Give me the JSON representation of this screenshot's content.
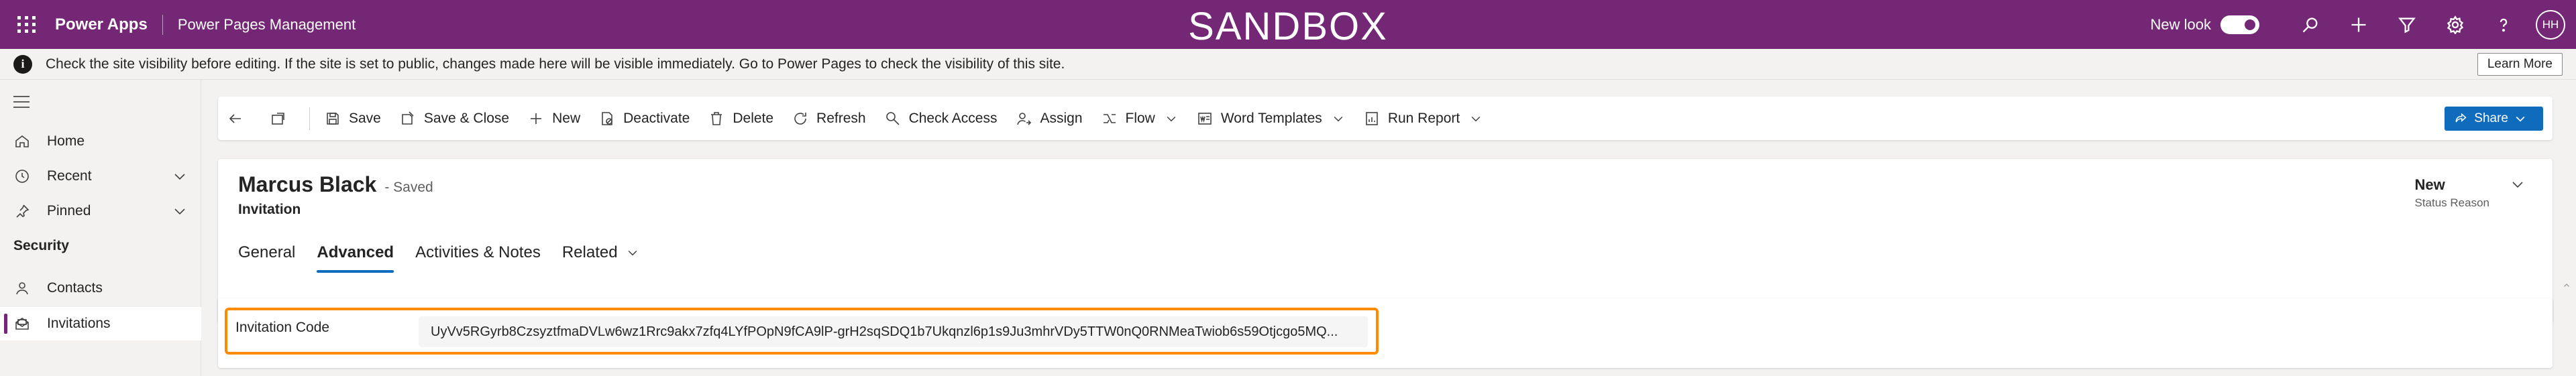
{
  "topbar": {
    "app_name": "Power Apps",
    "area_name": "Power Pages Management",
    "environment_banner": "SANDBOX",
    "new_look_label": "New look",
    "new_look_enabled": true,
    "avatar_initials": "HH",
    "icons": [
      "search-icon",
      "plus-icon",
      "filter-icon",
      "gear-icon",
      "help-icon"
    ],
    "brand_color": "#742774"
  },
  "notification": {
    "text": "Check the site visibility before editing. If the site is set to public, changes made here will be visible immediately. Go to Power Pages to check the visibility of this site.",
    "action_label": "Learn More"
  },
  "sidebar": {
    "items": [
      {
        "label": "Home",
        "icon": "home-icon"
      },
      {
        "label": "Recent",
        "icon": "clock-icon"
      },
      {
        "label": "Pinned",
        "icon": "pin-icon"
      }
    ],
    "section_title": "Security",
    "section_items": [
      {
        "label": "Contacts",
        "icon": "person-icon"
      },
      {
        "label": "Invitations",
        "icon": "mail-open-icon",
        "selected": true
      }
    ]
  },
  "commandbar": {
    "save": "Save",
    "save_close": "Save & Close",
    "new": "New",
    "deactivate": "Deactivate",
    "delete": "Delete",
    "refresh": "Refresh",
    "check_access": "Check Access",
    "assign": "Assign",
    "flow": "Flow",
    "word_templates": "Word Templates",
    "run_report": "Run Report",
    "share": "Share"
  },
  "record": {
    "name": "Marcus Black",
    "saved_state": "- Saved",
    "entity": "Invitation",
    "status_value": "New",
    "status_label": "Status Reason"
  },
  "tabs": [
    {
      "label": "General",
      "active": false
    },
    {
      "label": "Advanced",
      "active": true
    },
    {
      "label": "Activities & Notes",
      "active": false
    },
    {
      "label": "Related",
      "active": false
    }
  ],
  "form": {
    "invitation_code_label": "Invitation Code",
    "invitation_code_value": "UyVv5RGyrb8CzsyztfmaDVLw6wz1Rrc9akx7zfq4LYfPOpN9fCA9lP-grH2sqSDQ1b7Ukqnzl6p1s9Ju3mhrVDy5TTW0nQ0RNMeaTwiob6s59Otjcgo5MQ..."
  }
}
